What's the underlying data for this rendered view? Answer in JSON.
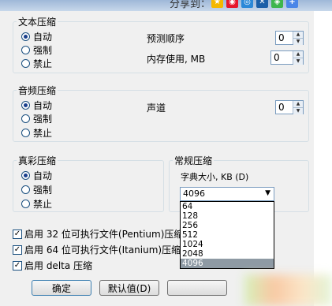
{
  "title": "",
  "share": {
    "label": "分享到：",
    "icons": [
      {
        "name": "qzone-icon",
        "color": "#f5b800"
      },
      {
        "name": "weibo-icon",
        "color": "#e6162d"
      },
      {
        "name": "tqq-icon",
        "color": "#2b88d8"
      },
      {
        "name": "renren-icon",
        "color": "#1a5ea8"
      },
      {
        "name": "wechat-icon",
        "color": "#3eb64c"
      },
      {
        "name": "more-icon",
        "color": "#4a86e8"
      }
    ]
  },
  "text_group": {
    "legend": "文本压缩",
    "options": [
      "自动",
      "强制",
      "禁止"
    ],
    "selected": 0,
    "predict_label": "预测顺序",
    "predict_value": "0",
    "memory_label": "内存使用, MB",
    "memory_value": "0"
  },
  "audio_group": {
    "legend": "音频压缩",
    "options": [
      "自动",
      "强制",
      "禁止"
    ],
    "selected": 0,
    "channel_label": "声道",
    "channel_value": "0"
  },
  "truecolor_group": {
    "legend": "真彩压缩",
    "options": [
      "自动",
      "强制",
      "禁止"
    ],
    "selected": 0
  },
  "general_group": {
    "legend": "常规压缩",
    "dict_label": "字典大小, KB (D)",
    "dict_value": "4096",
    "dict_options": [
      "64",
      "128",
      "256",
      "512",
      "1024",
      "2048",
      "4096"
    ],
    "dict_selected": 6
  },
  "checks": [
    {
      "label": "启用 32 位可执行文件(Pentium)压缩",
      "checked": true
    },
    {
      "label": "启用 64 位可执行文件(Itanium)压缩",
      "checked": true
    },
    {
      "label": "启用 delta 压缩",
      "checked": true
    }
  ],
  "buttons": {
    "ok": "确定",
    "default": "默认值(D)"
  },
  "check_mark": "✓",
  "spinner_up": "▲",
  "spinner_down": "▼",
  "combo_arrow": "▼"
}
